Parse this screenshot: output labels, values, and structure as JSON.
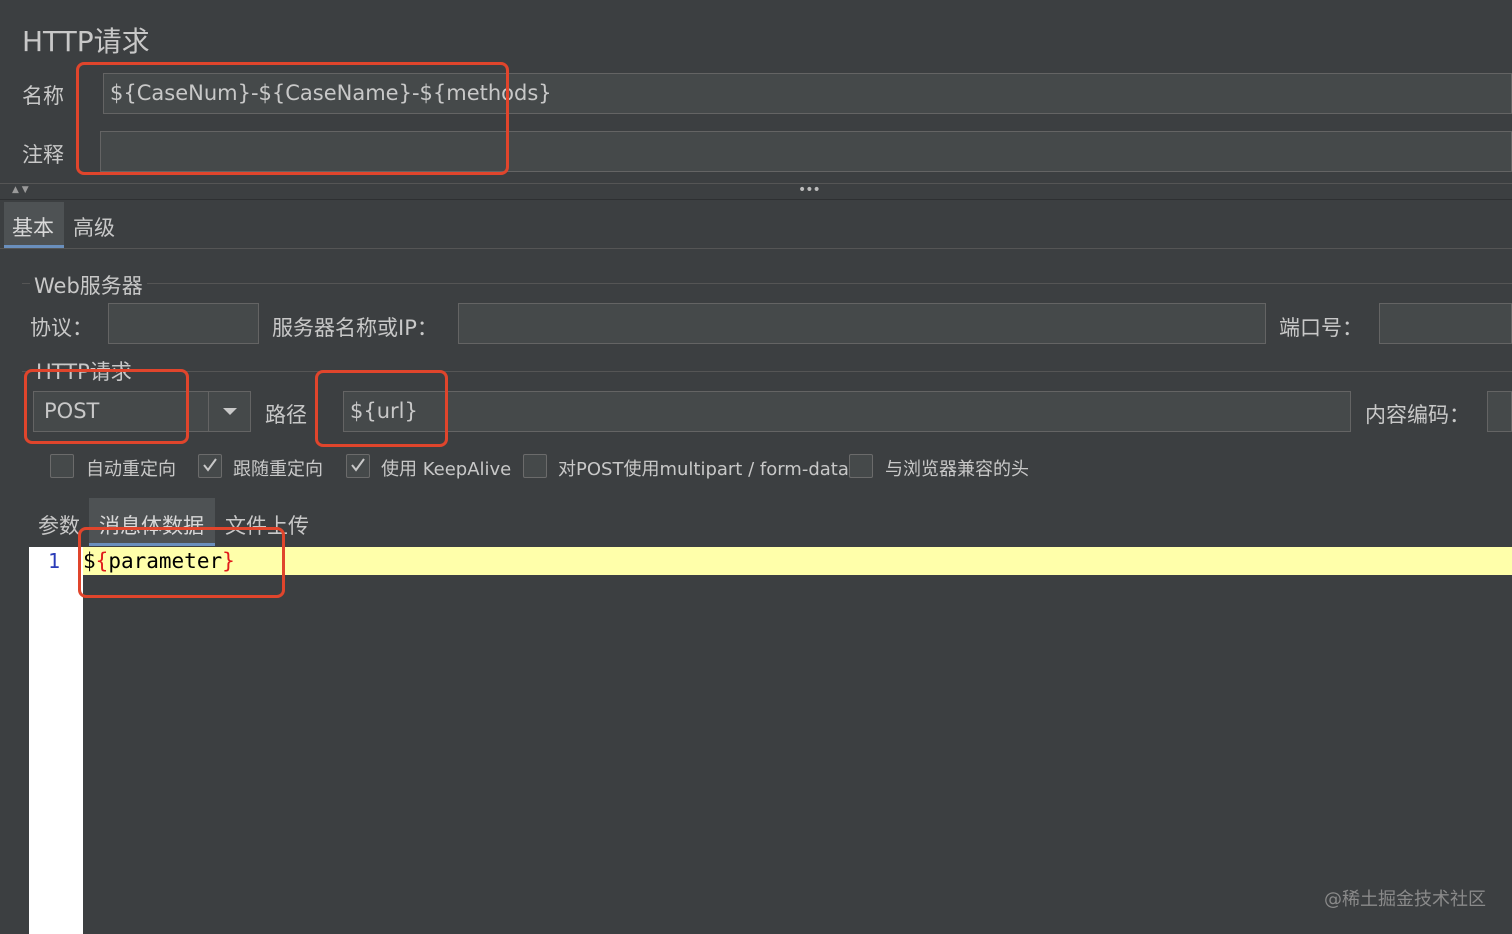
{
  "panel": {
    "title": "HTTP请求"
  },
  "name_field": {
    "label": "名称",
    "value": "${CaseNum}-${CaseName}-${methods}"
  },
  "comment_field": {
    "label": "注释",
    "value": ""
  },
  "tabs": [
    {
      "label": "基本"
    },
    {
      "label": "高级"
    }
  ],
  "web_server": {
    "group_label": "Web服务器",
    "protocol_label": "协议：",
    "protocol_value": "",
    "server_label": "服务器名称或IP：",
    "server_value": "",
    "port_label": "端口号：",
    "port_value": ""
  },
  "http_request": {
    "group_label": "HTTP请求",
    "method_value": "POST",
    "path_label": "路径",
    "path_value": "${url}",
    "encoding_label": "内容编码："
  },
  "checkboxes": [
    {
      "label": "自动重定向",
      "checked": false
    },
    {
      "label": "跟随重定向",
      "checked": true
    },
    {
      "label": "使用 KeepAlive",
      "checked": true
    },
    {
      "label": "对POST使用multipart / form-data",
      "checked": false
    },
    {
      "label": "与浏览器兼容的头",
      "checked": false
    }
  ],
  "subtabs": [
    {
      "label": "参数"
    },
    {
      "label": "消息体数据"
    },
    {
      "label": "文件上传"
    }
  ],
  "editor": {
    "line_number": "1",
    "code_prefix": "$",
    "code_open": "{",
    "code_body": "parameter",
    "code_close": "}"
  },
  "watermark": "@稀土掘金技术社区",
  "colors": {
    "background": "#3c3f41",
    "field_bg": "#45494a",
    "highlight_line": "#ffffaa",
    "annotation": "#e0452c"
  }
}
